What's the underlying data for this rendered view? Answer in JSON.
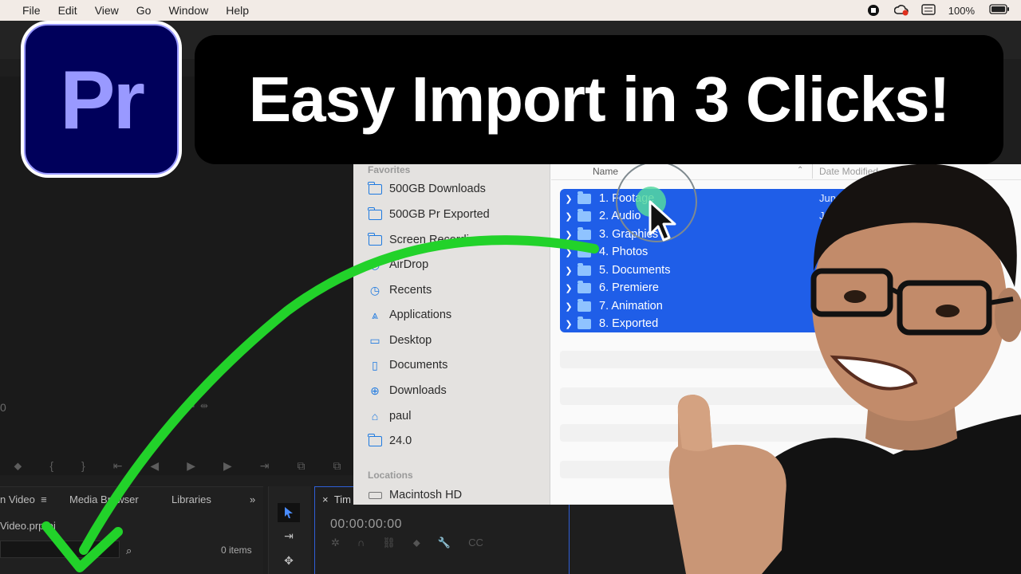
{
  "menubar": {
    "items": [
      "File",
      "Edit",
      "View",
      "Go",
      "Window",
      "Help"
    ],
    "battery": "100%"
  },
  "logo": {
    "text": "Pr"
  },
  "headline": "Easy Import in 3 Clicks!",
  "finder": {
    "sidebar": {
      "favorites_heading": "Favorites",
      "favorites": [
        {
          "label": "500GB Downloads",
          "icon": "folder-icon"
        },
        {
          "label": "500GB Pr Exported",
          "icon": "folder-icon"
        },
        {
          "label": "Screen Recordings",
          "icon": "folder-icon"
        },
        {
          "label": "AirDrop",
          "icon": "airdrop-icon"
        },
        {
          "label": "Recents",
          "icon": "clock-icon"
        },
        {
          "label": "Applications",
          "icon": "applications-icon"
        },
        {
          "label": "Desktop",
          "icon": "desktop-icon"
        },
        {
          "label": "Documents",
          "icon": "document-icon"
        },
        {
          "label": "Downloads",
          "icon": "download-icon"
        },
        {
          "label": "paul",
          "icon": "home-icon"
        },
        {
          "label": "24.0",
          "icon": "folder-icon"
        }
      ],
      "locations_heading": "Locations",
      "locations": [
        {
          "label": "Macintosh HD",
          "icon": "drive-icon"
        }
      ]
    },
    "columns": {
      "name": "Name",
      "date": "Date Modified"
    },
    "files": [
      {
        "name": "1. Footage",
        "date": "Jun 1"
      },
      {
        "name": "2. Audio",
        "date": "Jun"
      },
      {
        "name": "3. Graphics",
        "date": "Jun"
      },
      {
        "name": "4. Photos",
        "date": "Jun"
      },
      {
        "name": "5. Documents",
        "date": ""
      },
      {
        "name": "6. Premiere",
        "date": ""
      },
      {
        "name": "7. Animation",
        "date": ""
      },
      {
        "name": "8. Exported",
        "date": ""
      }
    ]
  },
  "premiere": {
    "project_tab": "n Video",
    "media_browser_tab": "Media Browser",
    "libraries_tab": "Libraries",
    "project_file": "Video.prproj",
    "items_count": "0 items",
    "timeline_tab": "Tim",
    "timecode": "00:00:00:00",
    "monitor_timecode": "0"
  },
  "colors": {
    "accent_selection": "#1f5ee8",
    "arrow": "#22d22a",
    "pr_logo_bg": "#00005b",
    "pr_logo_fg": "#9999ff"
  }
}
